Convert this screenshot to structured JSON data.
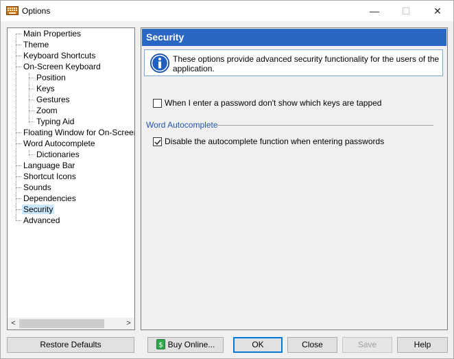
{
  "window": {
    "title": "Options",
    "controls": {
      "minimize": "—",
      "maximize": "☐",
      "close": "✕"
    }
  },
  "tree": {
    "items": [
      {
        "label": "Main Properties",
        "level": 0
      },
      {
        "label": "Theme",
        "level": 0
      },
      {
        "label": "Keyboard Shortcuts",
        "level": 0
      },
      {
        "label": "On-Screen Keyboard",
        "level": 0
      },
      {
        "label": "Position",
        "level": 1
      },
      {
        "label": "Keys",
        "level": 1
      },
      {
        "label": "Gestures",
        "level": 1
      },
      {
        "label": "Zoom",
        "level": 1
      },
      {
        "label": "Typing Aid",
        "level": 1
      },
      {
        "label": "Floating Window for On-Screen Ke",
        "level": 0
      },
      {
        "label": "Word Autocomplete",
        "level": 0
      },
      {
        "label": "Dictionaries",
        "level": 1
      },
      {
        "label": "Language Bar",
        "level": 0
      },
      {
        "label": "Shortcut Icons",
        "level": 0
      },
      {
        "label": "Sounds",
        "level": 0
      },
      {
        "label": "Dependencies",
        "level": 0
      },
      {
        "label": "Security",
        "level": 0,
        "selected": true
      },
      {
        "label": "Advanced",
        "level": 0
      }
    ],
    "scroll_left": "<",
    "scroll_right": ">"
  },
  "content": {
    "header": "Security",
    "info_text": "These options provide advanced security functionality for the users of the application.",
    "option_hide_keys": {
      "label": "When I enter a password don't show which keys are tapped",
      "checked": false
    },
    "group_word_autocomplete": "Word Autocomplete",
    "option_disable_autocomplete": {
      "label": "Disable the autocomplete function when entering passwords",
      "checked": true
    }
  },
  "buttons": {
    "restore_defaults": "Restore Defaults",
    "buy_online": "Buy Online...",
    "ok": "OK",
    "close": "Close",
    "save": "Save",
    "help": "Help"
  },
  "colors": {
    "header_bg": "#2a66c4",
    "selection_bg": "#cce8ff",
    "group_label": "#2255aa",
    "default_button_border": "#0078d7"
  }
}
